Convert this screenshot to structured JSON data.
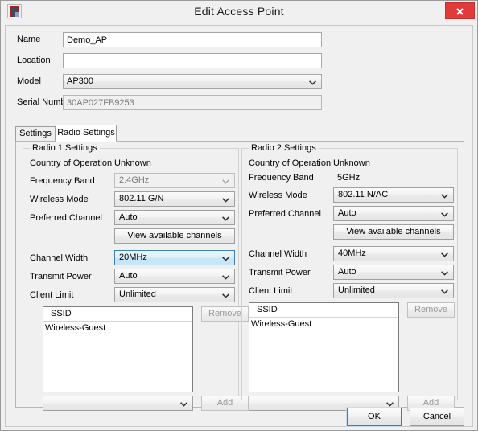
{
  "window": {
    "title": "Edit Access Point",
    "app_icon": "access-point-icon",
    "close_label": "close-icon"
  },
  "top_form": {
    "name": {
      "label": "Name",
      "value": "Demo_AP"
    },
    "location": {
      "label": "Location",
      "value": ""
    },
    "model": {
      "label": "Model",
      "value": "AP300"
    },
    "serial_number": {
      "label": "Serial Number",
      "value": "30AP027FB9253"
    }
  },
  "tabs": [
    {
      "label": "Settings",
      "active": false
    },
    {
      "label": "Radio Settings",
      "active": true
    }
  ],
  "radio1": {
    "group_title": "Radio 1 Settings",
    "country": {
      "label": "Country of Operation",
      "value": "Unknown"
    },
    "frequency_band": {
      "label": "Frequency Band",
      "value": "2.4GHz",
      "disabled": true
    },
    "wireless_mode": {
      "label": "Wireless Mode",
      "value": "802.11 G/N"
    },
    "preferred_channel": {
      "label": "Preferred Channel",
      "value": "Auto"
    },
    "view_channels_label": "View available channels",
    "channel_width": {
      "label": "Channel Width",
      "value": "20MHz",
      "highlighted": true
    },
    "transmit_power": {
      "label": "Transmit Power",
      "value": "Auto"
    },
    "client_limit": {
      "label": "Client Limit",
      "value": "Unlimited"
    },
    "ssid_table": {
      "header": "SSID",
      "rows": [
        "Wireless-Guest"
      ]
    },
    "remove_label": "Remove",
    "add_label": "Add",
    "ssid_picker_value": ""
  },
  "radio2": {
    "group_title": "Radio 2 Settings",
    "country": {
      "label": "Country of Operation",
      "value": "Unknown"
    },
    "frequency_band": {
      "label": "Frequency Band",
      "value": "5GHz",
      "static": true
    },
    "wireless_mode": {
      "label": "Wireless Mode",
      "value": "802.11 N/AC"
    },
    "preferred_channel": {
      "label": "Preferred Channel",
      "value": "Auto"
    },
    "view_channels_label": "View available channels",
    "channel_width": {
      "label": "Channel Width",
      "value": "40MHz"
    },
    "transmit_power": {
      "label": "Transmit Power",
      "value": "Auto"
    },
    "client_limit": {
      "label": "Client Limit",
      "value": "Unlimited"
    },
    "ssid_table": {
      "header": "SSID",
      "rows": [
        "Wireless-Guest"
      ]
    },
    "remove_label": "Remove",
    "add_label": "Add",
    "ssid_picker_value": ""
  },
  "footer": {
    "ok_label": "OK",
    "cancel_label": "Cancel"
  },
  "colors": {
    "close_red": "#e03a3a",
    "focus_blue": "#3c7fb1",
    "highlight_blue": "#c9e8f9",
    "window_bg": "#f0f0f0"
  }
}
